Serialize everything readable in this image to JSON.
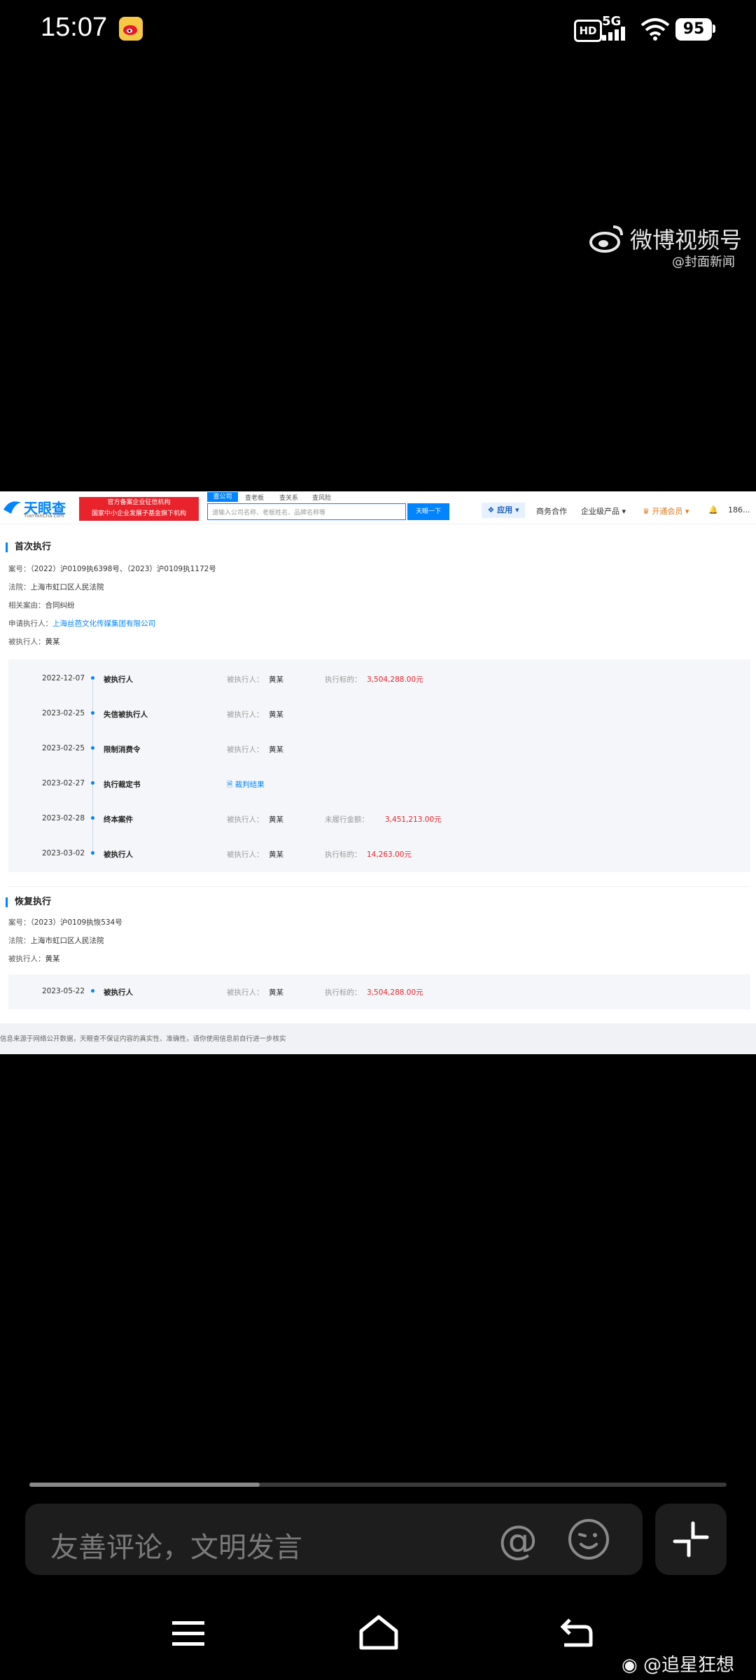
{
  "status_bar": {
    "time": "15:07",
    "network": "5G",
    "hd": "HD",
    "battery": "95",
    "icons": [
      "weibo-icon",
      "signal-icon",
      "wifi-icon",
      "battery-icon"
    ]
  },
  "watermark": {
    "title": "微博视频号",
    "subtitle": "@封面新闻"
  },
  "site": {
    "logo_text": "天眼查",
    "logo_sub": "TianYanCha.com",
    "promo_line1": "官方备案企业征信机构",
    "promo_line2": "国家中小企业发展子基金旗下机构",
    "search_tabs": [
      "查公司",
      "查老板",
      "查关系",
      "查风险"
    ],
    "search_placeholder": "请输入公司名称、老板姓名、品牌名称等",
    "search_button": "天眼一下",
    "nav": {
      "apps": "应用",
      "business": "商务合作",
      "enterprise": "企业级产品",
      "vip": "开通会员",
      "user": "186..."
    }
  },
  "section1": {
    "title": "首次执行",
    "case_label": "案号：",
    "case_value": "（2022）沪0109执6398号、（2023）沪0109执1172号",
    "court_label": "法院：",
    "court_value": "上海市虹口区人民法院",
    "cause_label": "相关案由：",
    "cause_value": "合同纠纷",
    "applicant_label": "申请执行人：",
    "applicant_value": "上海丝芭文化传媒集团有限公司",
    "respondent_label": "被执行人：",
    "respondent_value": "黄某",
    "rows": [
      {
        "date": "2022-12-07",
        "type": "被执行人",
        "party_label": "被执行人：",
        "party": "黄某",
        "amount_label": "执行标的：",
        "amount": "3,504,288.00元"
      },
      {
        "date": "2023-02-25",
        "type": "失信被执行人",
        "party_label": "被执行人：",
        "party": "黄某",
        "amount_label": "",
        "amount": ""
      },
      {
        "date": "2023-02-25",
        "type": "限制消费令",
        "party_label": "被执行人：",
        "party": "黄某",
        "amount_label": "",
        "amount": ""
      },
      {
        "date": "2023-02-27",
        "type": "执行裁定书",
        "doc_link": "裁判结果"
      },
      {
        "date": "2023-02-28",
        "type": "终本案件",
        "party_label": "被执行人：",
        "party": "黄某",
        "amount_label": "未履行金额：",
        "amount": "3,451,213.00元"
      },
      {
        "date": "2023-03-02",
        "type": "被执行人",
        "party_label": "被执行人：",
        "party": "黄某",
        "amount_label": "执行标的：",
        "amount": "14,263.00元"
      }
    ]
  },
  "section2": {
    "title": "恢复执行",
    "case_label": "案号：",
    "case_value": "（2023）沪0109执恢534号",
    "court_label": "法院：",
    "court_value": "上海市虹口区人民法院",
    "respondent_label": "被执行人：",
    "respondent_value": "黄某",
    "rows": [
      {
        "date": "2023-05-22",
        "type": "被执行人",
        "party_label": "被执行人：",
        "party": "黄某",
        "amount_label": "执行标的：",
        "amount": "3,504,288.00元"
      }
    ]
  },
  "disclaimer": "信息来源于网络公开数据，天眼查不保证内容的真实性、准确性，请你使用信息前自行进一步核实",
  "player": {
    "progress_fraction": 0.33,
    "comment_placeholder": "友善评论，文明发言",
    "at_symbol": "@",
    "user_watermark": "@追星狂想"
  }
}
